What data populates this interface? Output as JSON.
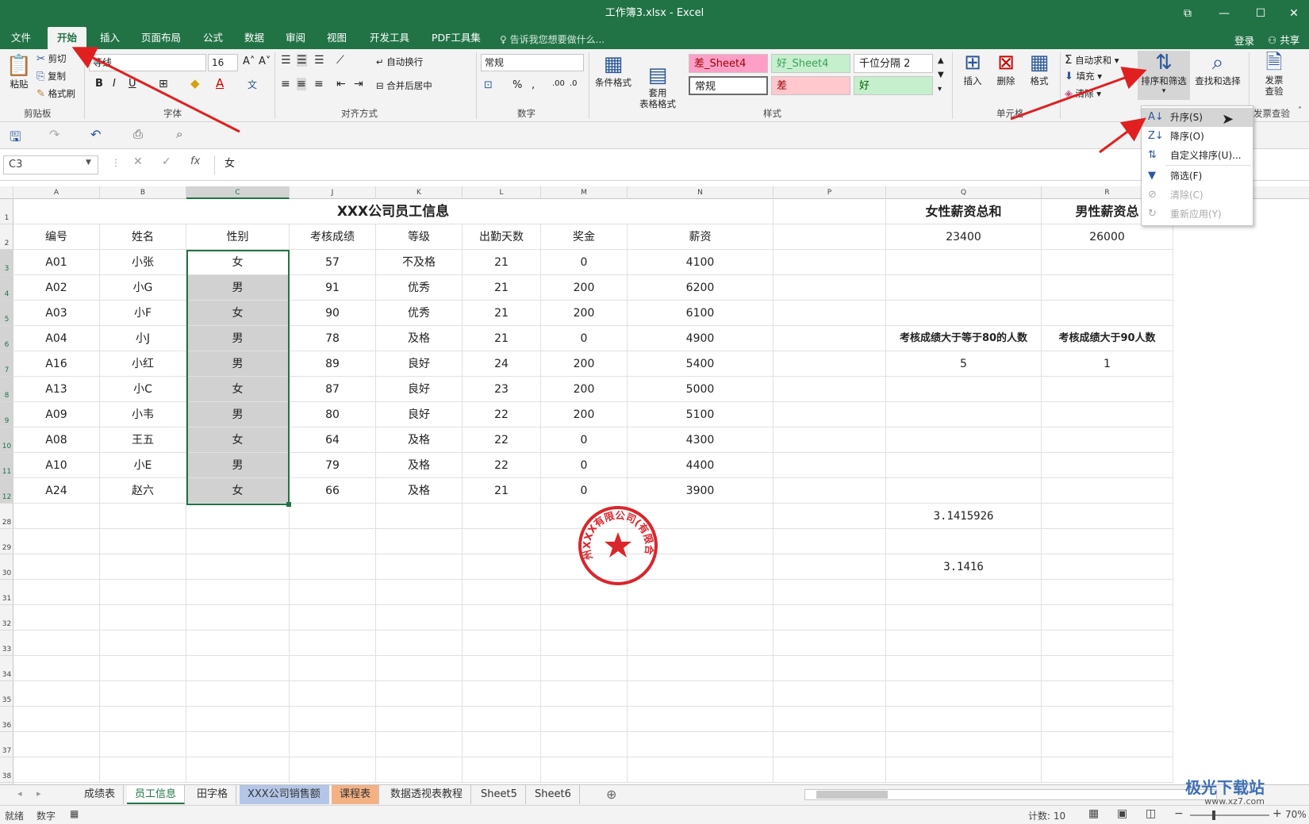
{
  "window": {
    "title": "工作簿3.xlsx - Excel"
  },
  "tabs": [
    "文件",
    "开始",
    "插入",
    "页面布局",
    "公式",
    "数据",
    "审阅",
    "视图",
    "开发工具",
    "PDF工具集"
  ],
  "tell_me": "告诉我您想要做什么...",
  "account": {
    "login": "登录",
    "share": "共享"
  },
  "ribbon": {
    "clipboard": {
      "paste": "粘贴",
      "cut": "剪切",
      "copy": "复制",
      "format_painter": "格式刷",
      "label": "剪贴板"
    },
    "font": {
      "family": "等线",
      "size": "16",
      "label": "字体"
    },
    "alignment": {
      "wrap": "自动换行",
      "merge": "合并后居中",
      "label": "对齐方式"
    },
    "number": {
      "format": "常规",
      "label": "数字"
    },
    "styles": {
      "conditional": "条件格式",
      "table_format": "套用\n表格格式",
      "cells": [
        "差_Sheet4",
        "好_Sheet4",
        "千位分隔 2",
        "常规",
        "差",
        "好"
      ],
      "label": "样式"
    },
    "cells_group": {
      "insert": "插入",
      "delete": "删除",
      "format": "格式",
      "label": "单元格"
    },
    "editing": {
      "autosum": "自动求和",
      "fill": "填充",
      "clear": "清除",
      "sort_filter": "排序和筛选",
      "find_select": "查找和选择"
    },
    "invoice": {
      "label1": "发票",
      "label2": "查验",
      "group": "发票查验"
    }
  },
  "formula_bar": {
    "name_box": "C3",
    "content": "女"
  },
  "columns": [
    "A",
    "B",
    "C",
    "J",
    "K",
    "L",
    "M",
    "N",
    "P",
    "Q",
    "R"
  ],
  "rows": [
    "1",
    "2",
    "3",
    "4",
    "5",
    "6",
    "7",
    "8",
    "9",
    "10",
    "11",
    "12",
    "28",
    "29",
    "30",
    "31",
    "32",
    "33",
    "34",
    "35",
    "36",
    "37",
    "38"
  ],
  "sheet": {
    "title": "XXX公司员工信息",
    "headers": [
      "编号",
      "姓名",
      "性别",
      "考核成绩",
      "等级",
      "出勤天数",
      "奖金",
      "薪资"
    ],
    "data": [
      [
        "A01",
        "小张",
        "女",
        "57",
        "不及格",
        "21",
        "0",
        "4100"
      ],
      [
        "A02",
        "小G",
        "男",
        "91",
        "优秀",
        "21",
        "200",
        "6200"
      ],
      [
        "A03",
        "小F",
        "女",
        "90",
        "优秀",
        "21",
        "200",
        "6100"
      ],
      [
        "A04",
        "小J",
        "男",
        "78",
        "及格",
        "21",
        "0",
        "4900"
      ],
      [
        "A16",
        "小红",
        "男",
        "89",
        "良好",
        "24",
        "200",
        "5400"
      ],
      [
        "A13",
        "小C",
        "女",
        "87",
        "良好",
        "23",
        "200",
        "5000"
      ],
      [
        "A09",
        "小韦",
        "男",
        "80",
        "良好",
        "22",
        "200",
        "5100"
      ],
      [
        "A08",
        "王五",
        "女",
        "64",
        "及格",
        "22",
        "0",
        "4300"
      ],
      [
        "A10",
        "小E",
        "男",
        "79",
        "及格",
        "22",
        "0",
        "4400"
      ],
      [
        "A24",
        "赵六",
        "女",
        "66",
        "及格",
        "21",
        "0",
        "3900"
      ]
    ],
    "female_total_label": "女性薪资总和",
    "male_total_label": "男性薪资总",
    "female_total": "23400",
    "male_total": "26000",
    "count80_label": "考核成绩大于等于80的人数",
    "count90_label": "考核成绩大于90人数",
    "count80": "5",
    "count90": "1",
    "pi_full": "3.1415926",
    "pi_rounded": "3.1416"
  },
  "stamp": {
    "text": "广州XXX有限公司(有限合伙)",
    "color": "#d9262c"
  },
  "sort_menu": [
    {
      "label": "升序(S)",
      "icon": "sort-ascending-icon",
      "enabled": true
    },
    {
      "label": "降序(O)",
      "icon": "sort-descending-icon",
      "enabled": true
    },
    {
      "label": "自定义排序(U)...",
      "icon": "custom-sort-icon",
      "enabled": true
    },
    {
      "label": "筛选(F)",
      "icon": "filter-icon",
      "enabled": true
    },
    {
      "label": "清除(C)",
      "icon": "clear-filter-icon",
      "enabled": false
    },
    {
      "label": "重新应用(Y)",
      "icon": "reapply-icon",
      "enabled": false
    }
  ],
  "sheet_tabs": [
    "成绩表",
    "员工信息",
    "田字格",
    "XXX公司销售额",
    "课程表",
    "数据透视表教程",
    "Sheet5",
    "Sheet6"
  ],
  "status": {
    "ready": "就绪",
    "mode": "数字",
    "count": "计数: 10",
    "zoom": "70%"
  },
  "watermark": {
    "line1": "极光下载站",
    "line2": "www.xz7.com"
  },
  "colors": {
    "excel_green": "#217346",
    "arrow_red": "#e02020"
  }
}
